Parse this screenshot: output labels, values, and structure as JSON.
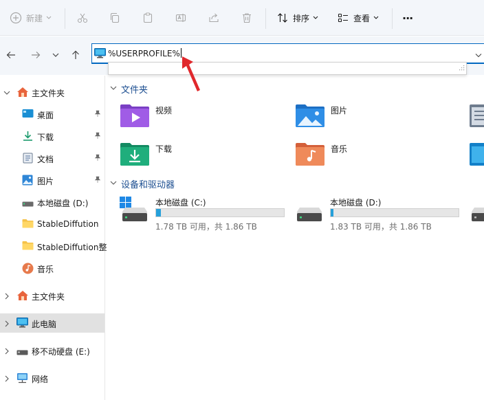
{
  "toolbar": {
    "new_label": "新建",
    "sort_label": "排序",
    "view_label": "查看",
    "more_label": "···"
  },
  "address": {
    "value": "%USERPROFILE%"
  },
  "sidebar": {
    "items": [
      {
        "label": "主文件夹"
      },
      {
        "label": "桌面"
      },
      {
        "label": "下载"
      },
      {
        "label": "文档"
      },
      {
        "label": "图片"
      },
      {
        "label": "本地磁盘 (D:)"
      },
      {
        "label": "StableDiffution"
      },
      {
        "label": "StableDiffution整"
      },
      {
        "label": "音乐"
      },
      {
        "label": "主文件夹"
      },
      {
        "label": "此电脑"
      },
      {
        "label": "移不动硬盘 (E:)"
      },
      {
        "label": "网络"
      }
    ]
  },
  "main": {
    "folders_title": "文件夹",
    "folders": [
      {
        "label": "视频"
      },
      {
        "label": "图片"
      },
      {
        "label": "下载"
      },
      {
        "label": "音乐"
      }
    ],
    "drives_title": "设备和驱动器",
    "drives": [
      {
        "label": "本地磁盘 (C:)",
        "space": "1.78 TB 可用，共 1.86 TB",
        "used_fraction": 0.04
      },
      {
        "label": "本地磁盘 (D:)",
        "space": "1.83 TB 可用，共 1.86 TB",
        "used_fraction": 0.02
      }
    ]
  },
  "colors": {
    "accent": "#0067c0",
    "drive_bar": "#26a0da",
    "arrow": "#e0282c",
    "selection": "#e1e1e1"
  }
}
